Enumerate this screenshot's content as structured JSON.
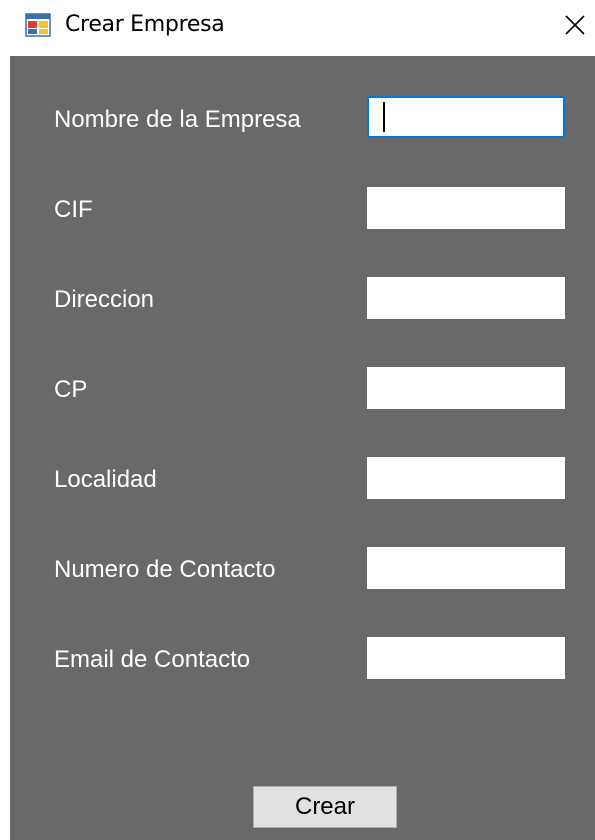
{
  "window": {
    "title": "Crear Empresa",
    "close_icon": "close-icon",
    "app_icon": "form-app-icon"
  },
  "form": {
    "fields": [
      {
        "label": "Nombre de la Empresa",
        "value": "",
        "focused": true
      },
      {
        "label": "CIF",
        "value": ""
      },
      {
        "label": "Direccion",
        "value": ""
      },
      {
        "label": "CP",
        "value": ""
      },
      {
        "label": "Localidad",
        "value": ""
      },
      {
        "label": "Numero de Contacto",
        "value": ""
      },
      {
        "label": "Email de Contacto",
        "value": ""
      }
    ],
    "submit_label": "Crear"
  },
  "colors": {
    "background": "#696969",
    "focus_border": "#0078d7",
    "button_bg": "#e1e1e1"
  }
}
